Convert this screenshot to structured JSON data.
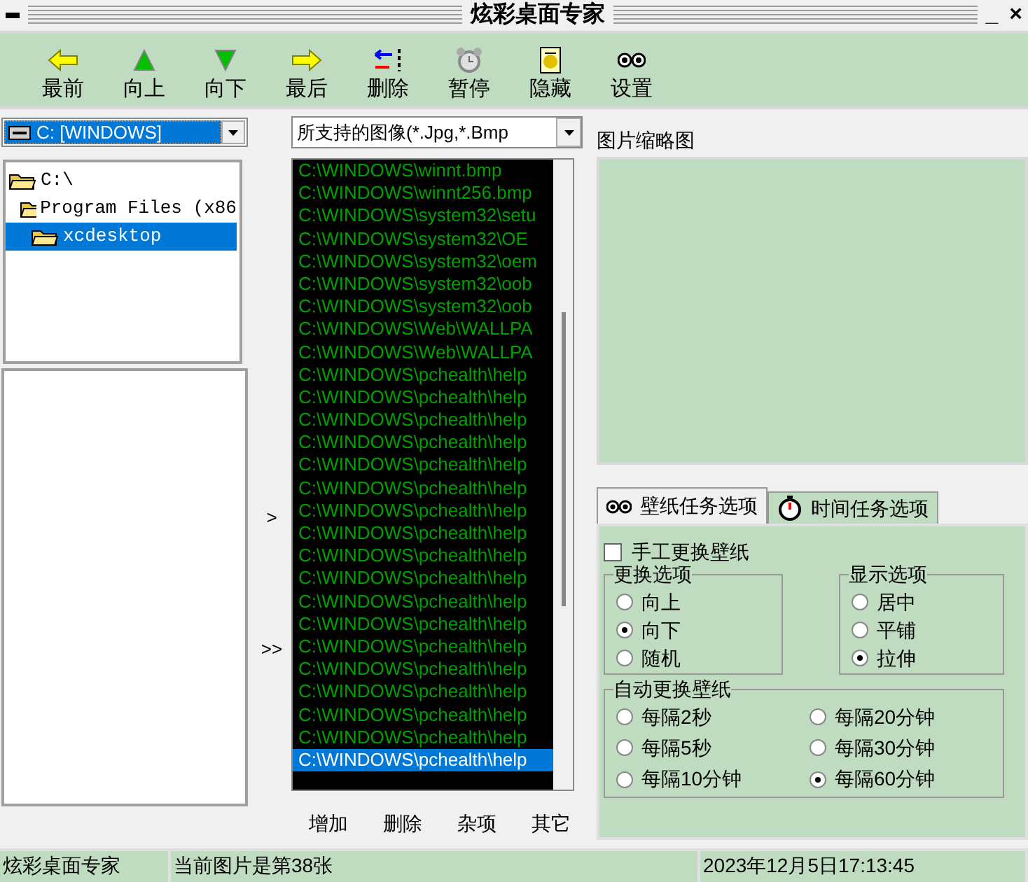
{
  "window": {
    "title": "炫彩桌面专家",
    "controls": [
      "_",
      "×"
    ]
  },
  "toolbar": [
    {
      "label": "最前"
    },
    {
      "label": "向上"
    },
    {
      "label": "向下"
    },
    {
      "label": "最后"
    },
    {
      "label": "删除"
    },
    {
      "label": "暂停"
    },
    {
      "label": "隐藏"
    },
    {
      "label": "设置"
    }
  ],
  "drive_combo": {
    "value": "C: [WINDOWS]"
  },
  "folder_tree": [
    {
      "label": "C:\\",
      "selected": false,
      "children": [
        {
          "label": "Program Files (x86",
          "selected": false,
          "children": [
            {
              "label": "xcdesktop",
              "selected": true
            }
          ]
        }
      ]
    }
  ],
  "transfer_buttons": [
    ">",
    ">>"
  ],
  "filter_combo": {
    "value": "所支持的图像(*.Jpg,*.Bmp"
  },
  "files": [
    {
      "path": "C:\\WINDOWS\\winnt.bmp",
      "selected": false
    },
    {
      "path": "C:\\WINDOWS\\winnt256.bmp",
      "selected": false
    },
    {
      "path": "C:\\WINDOWS\\system32\\setu",
      "selected": false
    },
    {
      "path": "C:\\WINDOWS\\system32\\OE",
      "selected": false
    },
    {
      "path": "C:\\WINDOWS\\system32\\oem",
      "selected": false
    },
    {
      "path": "C:\\WINDOWS\\system32\\oob",
      "selected": false
    },
    {
      "path": "C:\\WINDOWS\\system32\\oob",
      "selected": false
    },
    {
      "path": "C:\\WINDOWS\\Web\\WALLPA",
      "selected": false
    },
    {
      "path": "C:\\WINDOWS\\Web\\WALLPA",
      "selected": false
    },
    {
      "path": "C:\\WINDOWS\\pchealth\\help",
      "selected": false
    },
    {
      "path": "C:\\WINDOWS\\pchealth\\help",
      "selected": false
    },
    {
      "path": "C:\\WINDOWS\\pchealth\\help",
      "selected": false
    },
    {
      "path": "C:\\WINDOWS\\pchealth\\help",
      "selected": false
    },
    {
      "path": "C:\\WINDOWS\\pchealth\\help",
      "selected": false
    },
    {
      "path": "C:\\WINDOWS\\pchealth\\help",
      "selected": false
    },
    {
      "path": "C:\\WINDOWS\\pchealth\\help",
      "selected": false
    },
    {
      "path": "C:\\WINDOWS\\pchealth\\help",
      "selected": false
    },
    {
      "path": "C:\\WINDOWS\\pchealth\\help",
      "selected": false
    },
    {
      "path": "C:\\WINDOWS\\pchealth\\help",
      "selected": false
    },
    {
      "path": "C:\\WINDOWS\\pchealth\\help",
      "selected": false
    },
    {
      "path": "C:\\WINDOWS\\pchealth\\help",
      "selected": false
    },
    {
      "path": "C:\\WINDOWS\\pchealth\\help",
      "selected": false
    },
    {
      "path": "C:\\WINDOWS\\pchealth\\help",
      "selected": false
    },
    {
      "path": "C:\\WINDOWS\\pchealth\\help",
      "selected": false
    },
    {
      "path": "C:\\WINDOWS\\pchealth\\help",
      "selected": false
    },
    {
      "path": "C:\\WINDOWS\\pchealth\\help",
      "selected": false
    },
    {
      "path": "C:\\WINDOWS\\pchealth\\help",
      "selected": true
    }
  ],
  "list_buttons": [
    "增加",
    "删除",
    "杂项",
    "其它"
  ],
  "preview": {
    "label": "图片缩略图"
  },
  "tabs": [
    {
      "label": "壁纸任务选项",
      "selected": true
    },
    {
      "label": "时间任务选项",
      "selected": false
    }
  ],
  "manual_change": {
    "label": "手工更换壁纸",
    "checked": false
  },
  "change_options": {
    "title": "更换选项",
    "options": [
      {
        "label": "向上",
        "selected": false
      },
      {
        "label": "向下",
        "selected": true
      },
      {
        "label": "随机",
        "selected": false
      }
    ]
  },
  "display_options": {
    "title": "显示选项",
    "options": [
      {
        "label": "居中",
        "selected": false
      },
      {
        "label": "平铺",
        "selected": false
      },
      {
        "label": "拉伸",
        "selected": true
      }
    ]
  },
  "auto_change": {
    "title": "自动更换壁纸",
    "options": [
      {
        "label": "每隔2秒",
        "selected": false
      },
      {
        "label": "每隔20分钟",
        "selected": false
      },
      {
        "label": "每隔5秒",
        "selected": false
      },
      {
        "label": "每隔30分钟",
        "selected": false
      },
      {
        "label": "每隔10分钟",
        "selected": false
      },
      {
        "label": "每隔60分钟",
        "selected": true
      }
    ]
  },
  "status_bar": [
    "炫彩桌面专家",
    "当前图片是第38张",
    "2023年12月5日17:13:45"
  ]
}
